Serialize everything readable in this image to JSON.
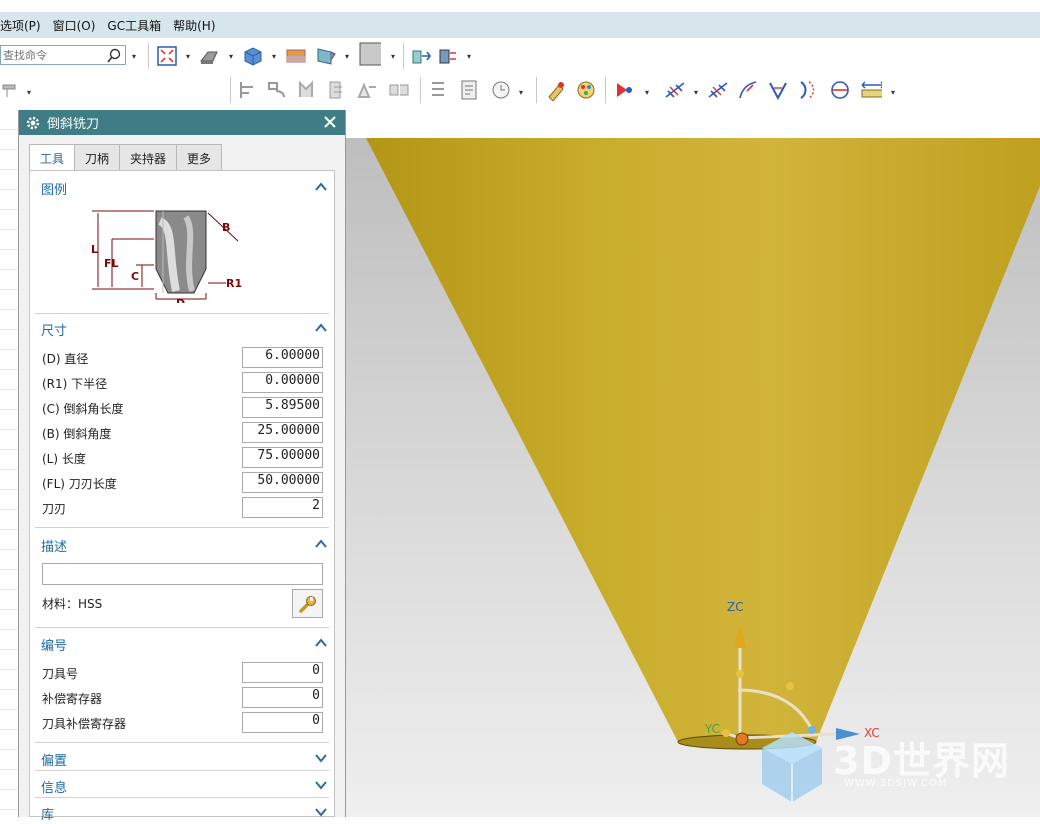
{
  "menu": [
    "选项(P)",
    "窗口(O)",
    "GC工具箱",
    "帮助(H)"
  ],
  "command_search": {
    "placeholder": "查找命令"
  },
  "dialog": {
    "title": "倒斜铣刀",
    "tabs": [
      "工具",
      "刀柄",
      "夹持器",
      "更多"
    ],
    "active_tab": "工具",
    "sections": {
      "legend": {
        "label": "图例",
        "diagram_labels": {
          "L": "L",
          "FL": "FL",
          "C": "C",
          "D": "D",
          "B": "B",
          "R1": "R1"
        }
      },
      "dimensions": {
        "label": "尺寸",
        "fields": [
          {
            "label": "(D) 直径",
            "value": "6.00000"
          },
          {
            "label": "(R1) 下半径",
            "value": "0.00000"
          },
          {
            "label": "(C) 倒斜角长度",
            "value": "5.89500"
          },
          {
            "label": "(B) 倒斜角度",
            "value": "25.00000"
          },
          {
            "label": "(L) 长度",
            "value": "75.00000"
          },
          {
            "label": "(FL) 刀刃长度",
            "value": "50.00000"
          },
          {
            "label": "刀刃",
            "value": "2"
          }
        ]
      },
      "description": {
        "label": "描述",
        "value": "",
        "material": "材料：HSS"
      },
      "numbering": {
        "label": "编号",
        "fields": [
          {
            "label": "刀具号",
            "value": "0"
          },
          {
            "label": "补偿寄存器",
            "value": "0"
          },
          {
            "label": "刀具补偿寄存器",
            "value": "0"
          }
        ]
      },
      "offset": {
        "label": "偏置"
      },
      "info": {
        "label": "信息"
      },
      "library": {
        "label": "库"
      }
    }
  },
  "viewport": {
    "axes": {
      "z": "ZC",
      "x": "XC",
      "y": "YC"
    },
    "colors": {
      "cone": "#c9a92a",
      "axis_z": "#d4a21a",
      "axis_x": "#5aa0d8"
    }
  },
  "watermark": {
    "title": "3D世界网",
    "url": "WWW.3DSJW.COM"
  }
}
